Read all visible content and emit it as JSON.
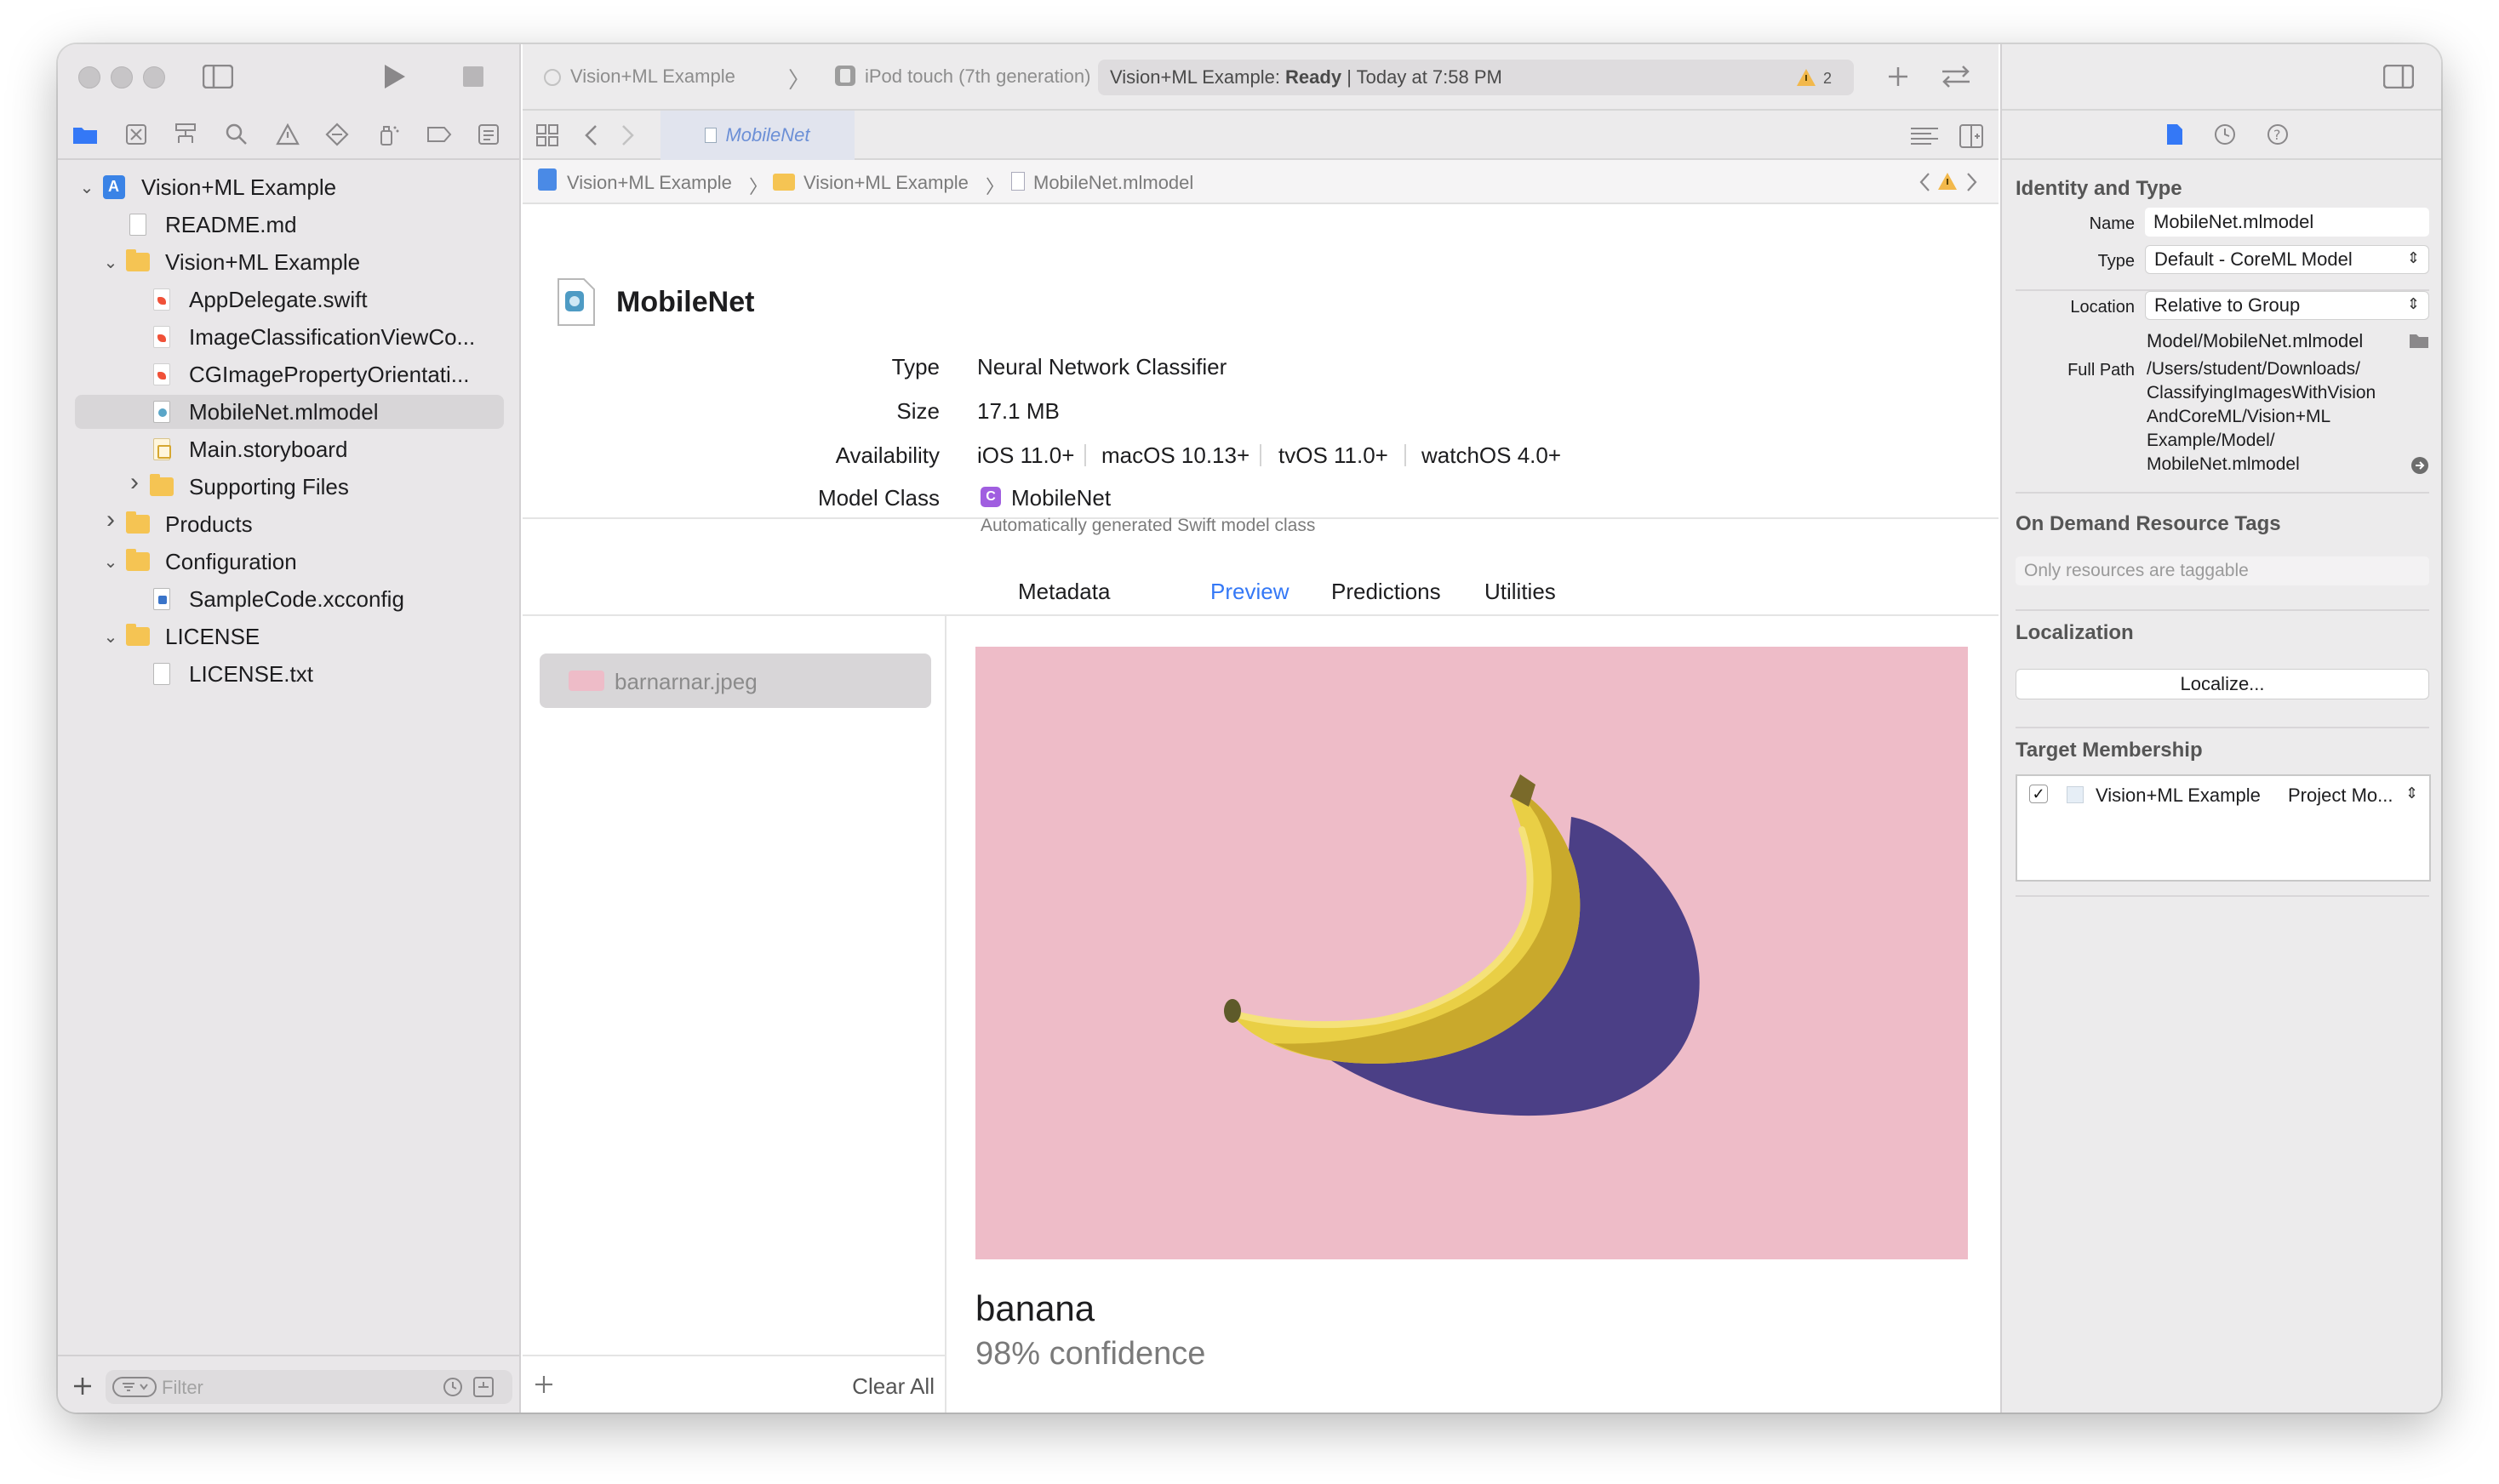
{
  "navigator": {
    "filter_placeholder": "Filter",
    "tree": [
      {
        "label": "Vision+ML Example",
        "icon": "project-icon",
        "disclosure": "expanded",
        "depth": 0
      },
      {
        "label": "README.md",
        "icon": "text-file-icon",
        "disclosure": "none",
        "depth": 1
      },
      {
        "label": "Vision+ML Example",
        "icon": "folder-icon",
        "disclosure": "expanded",
        "depth": 1
      },
      {
        "label": "AppDelegate.swift",
        "icon": "swift-file-icon",
        "disclosure": "none",
        "depth": 2
      },
      {
        "label": "ImageClassificationViewCo...",
        "icon": "swift-file-icon",
        "disclosure": "none",
        "depth": 2
      },
      {
        "label": "CGImagePropertyOrientati...",
        "icon": "swift-file-icon",
        "disclosure": "none",
        "depth": 2
      },
      {
        "label": "MobileNet.mlmodel",
        "icon": "mlmodel-file-icon",
        "disclosure": "none",
        "depth": 2,
        "selected": true
      },
      {
        "label": "Main.storyboard",
        "icon": "storyboard-file-icon",
        "disclosure": "none",
        "depth": 2
      },
      {
        "label": "Supporting Files",
        "icon": "folder-icon",
        "disclosure": "collapsed",
        "depth": 2
      },
      {
        "label": "Products",
        "icon": "folder-icon",
        "disclosure": "collapsed",
        "depth": 1
      },
      {
        "label": "Configuration",
        "icon": "folder-icon",
        "disclosure": "expanded",
        "depth": 1
      },
      {
        "label": "SampleCode.xcconfig",
        "icon": "xcconfig-file-icon",
        "disclosure": "none",
        "depth": 2
      },
      {
        "label": "LICENSE",
        "icon": "folder-icon",
        "disclosure": "expanded",
        "depth": 1
      },
      {
        "label": "LICENSE.txt",
        "icon": "text-file-icon",
        "disclosure": "none",
        "depth": 2
      }
    ]
  },
  "toolbar": {
    "scheme": "Vision+ML Example",
    "destination": "iPod touch (7th generation)",
    "activity_prefix": "Vision+ML Example: ",
    "activity_status": "Ready",
    "activity_time": " | Today at 7:58 PM",
    "warning_count": "2"
  },
  "editor": {
    "tab_label": "MobileNet",
    "breadcrumb": [
      "Vision+ML Example",
      "Vision+ML Example",
      "MobileNet.mlmodel"
    ],
    "model": {
      "name": "MobileNet",
      "type_label": "Type",
      "type_value": "Neural Network Classifier",
      "size_label": "Size",
      "size_value": "17.1 MB",
      "availability_label": "Availability",
      "availability": [
        "iOS 11.0+",
        "macOS 10.13+",
        "tvOS 11.0+",
        "watchOS 4.0+"
      ],
      "class_label": "Model Class",
      "class_badge": "C",
      "class_value": "MobileNet",
      "class_note": "Automatically generated Swift model class"
    },
    "segments": [
      "Metadata",
      "Preview",
      "Predictions",
      "Utilities"
    ],
    "active_segment": "Preview",
    "preview_files": [
      {
        "label": "barnarnar.jpeg"
      }
    ],
    "clear_all": "Clear All",
    "prediction": {
      "label": "banana",
      "confidence": "98% confidence"
    }
  },
  "inspector": {
    "identity_heading": "Identity and Type",
    "name_label": "Name",
    "name_value": "MobileNet.mlmodel",
    "type_label": "Type",
    "type_value": "Default - CoreML Model",
    "location_label": "Location",
    "location_value": "Relative to Group",
    "relative_path": "Model/MobileNet.mlmodel",
    "full_path_label": "Full Path",
    "full_path_lines": [
      "/Users/student/Downloads/",
      "ClassifyingImagesWithVision",
      "AndCoreML/Vision+ML",
      "Example/Model/",
      "MobileNet.mlmodel"
    ],
    "odr_heading": "On Demand Resource Tags",
    "odr_placeholder": "Only resources are taggable",
    "localization_heading": "Localization",
    "localize_button": "Localize...",
    "membership_heading": "Target Membership",
    "membership": {
      "target": "Vision+ML Example",
      "role": "Project Mo...",
      "checked": true
    }
  },
  "colors": {
    "accent": "#3478f6",
    "folder": "#f5c453",
    "warning": "#f2b84b",
    "model_class_badge": "#a05ee0",
    "preview_background": "#eebcc8"
  }
}
